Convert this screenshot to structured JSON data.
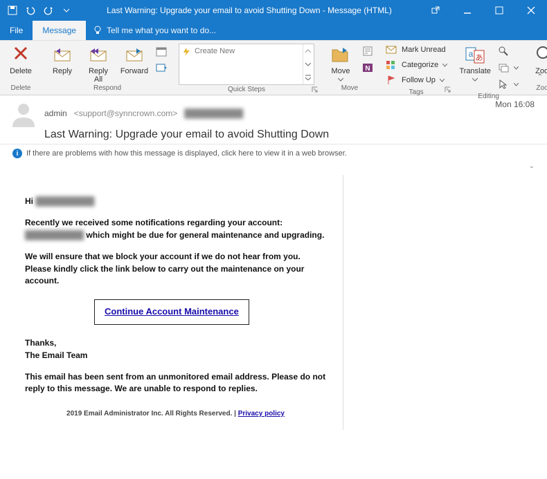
{
  "titlebar": {
    "title": "Last Warning: Upgrade your email to avoid Shutting Down - Message (HTML)"
  },
  "tabs": {
    "file": "File",
    "message": "Message",
    "tellme": "Tell me what you want to do..."
  },
  "ribbon": {
    "delete": {
      "label": "Delete",
      "btn": "Delete"
    },
    "respond": {
      "label": "Respond",
      "reply": "Reply",
      "replyall": "Reply\nAll",
      "forward": "Forward"
    },
    "quicksteps": {
      "label": "Quick Steps",
      "create": "Create New"
    },
    "move": {
      "label": "Move",
      "btn": "Move"
    },
    "tags": {
      "label": "Tags",
      "unread": "Mark Unread",
      "categorize": "Categorize",
      "followup": "Follow Up"
    },
    "editing": {
      "label": "Editing"
    },
    "translate": {
      "label": "Translate"
    },
    "zoom": {
      "label": "Zoom",
      "btn": "Zoom"
    }
  },
  "header": {
    "from_name": "admin",
    "from_email": "<support@synncrown.com>",
    "recipient_blur": "██████████",
    "timestamp": "Mon 16:08",
    "subject": "Last Warning: Upgrade your email to avoid Shutting Down",
    "infobar": "If there are problems with how this message is displayed, click here to view it in a web browser."
  },
  "body": {
    "greeting_prefix": "Hi ",
    "greeting_blur": "██████████",
    "p1_pre": "Recently we received some notifications regarding your account: ",
    "p1_blur": "██████████",
    "p1_post": " which might be due for general maintenance and upgrading.",
    "p2": "We will ensure that we block your account if we do not hear from you. Please kindly click the link below to carry out the maintenance on your account.",
    "cta": "Continue Account Maintenance",
    "thanks": "Thanks,",
    "team": "The Email Team",
    "disclaimer": "This email has been sent from an unmonitored email address. Please do not reply to this message. We are unable to respond to replies.",
    "footer_text": "2019 Email Administrator Inc. All Rights Reserved. | ",
    "footer_link": "Privacy policy"
  }
}
